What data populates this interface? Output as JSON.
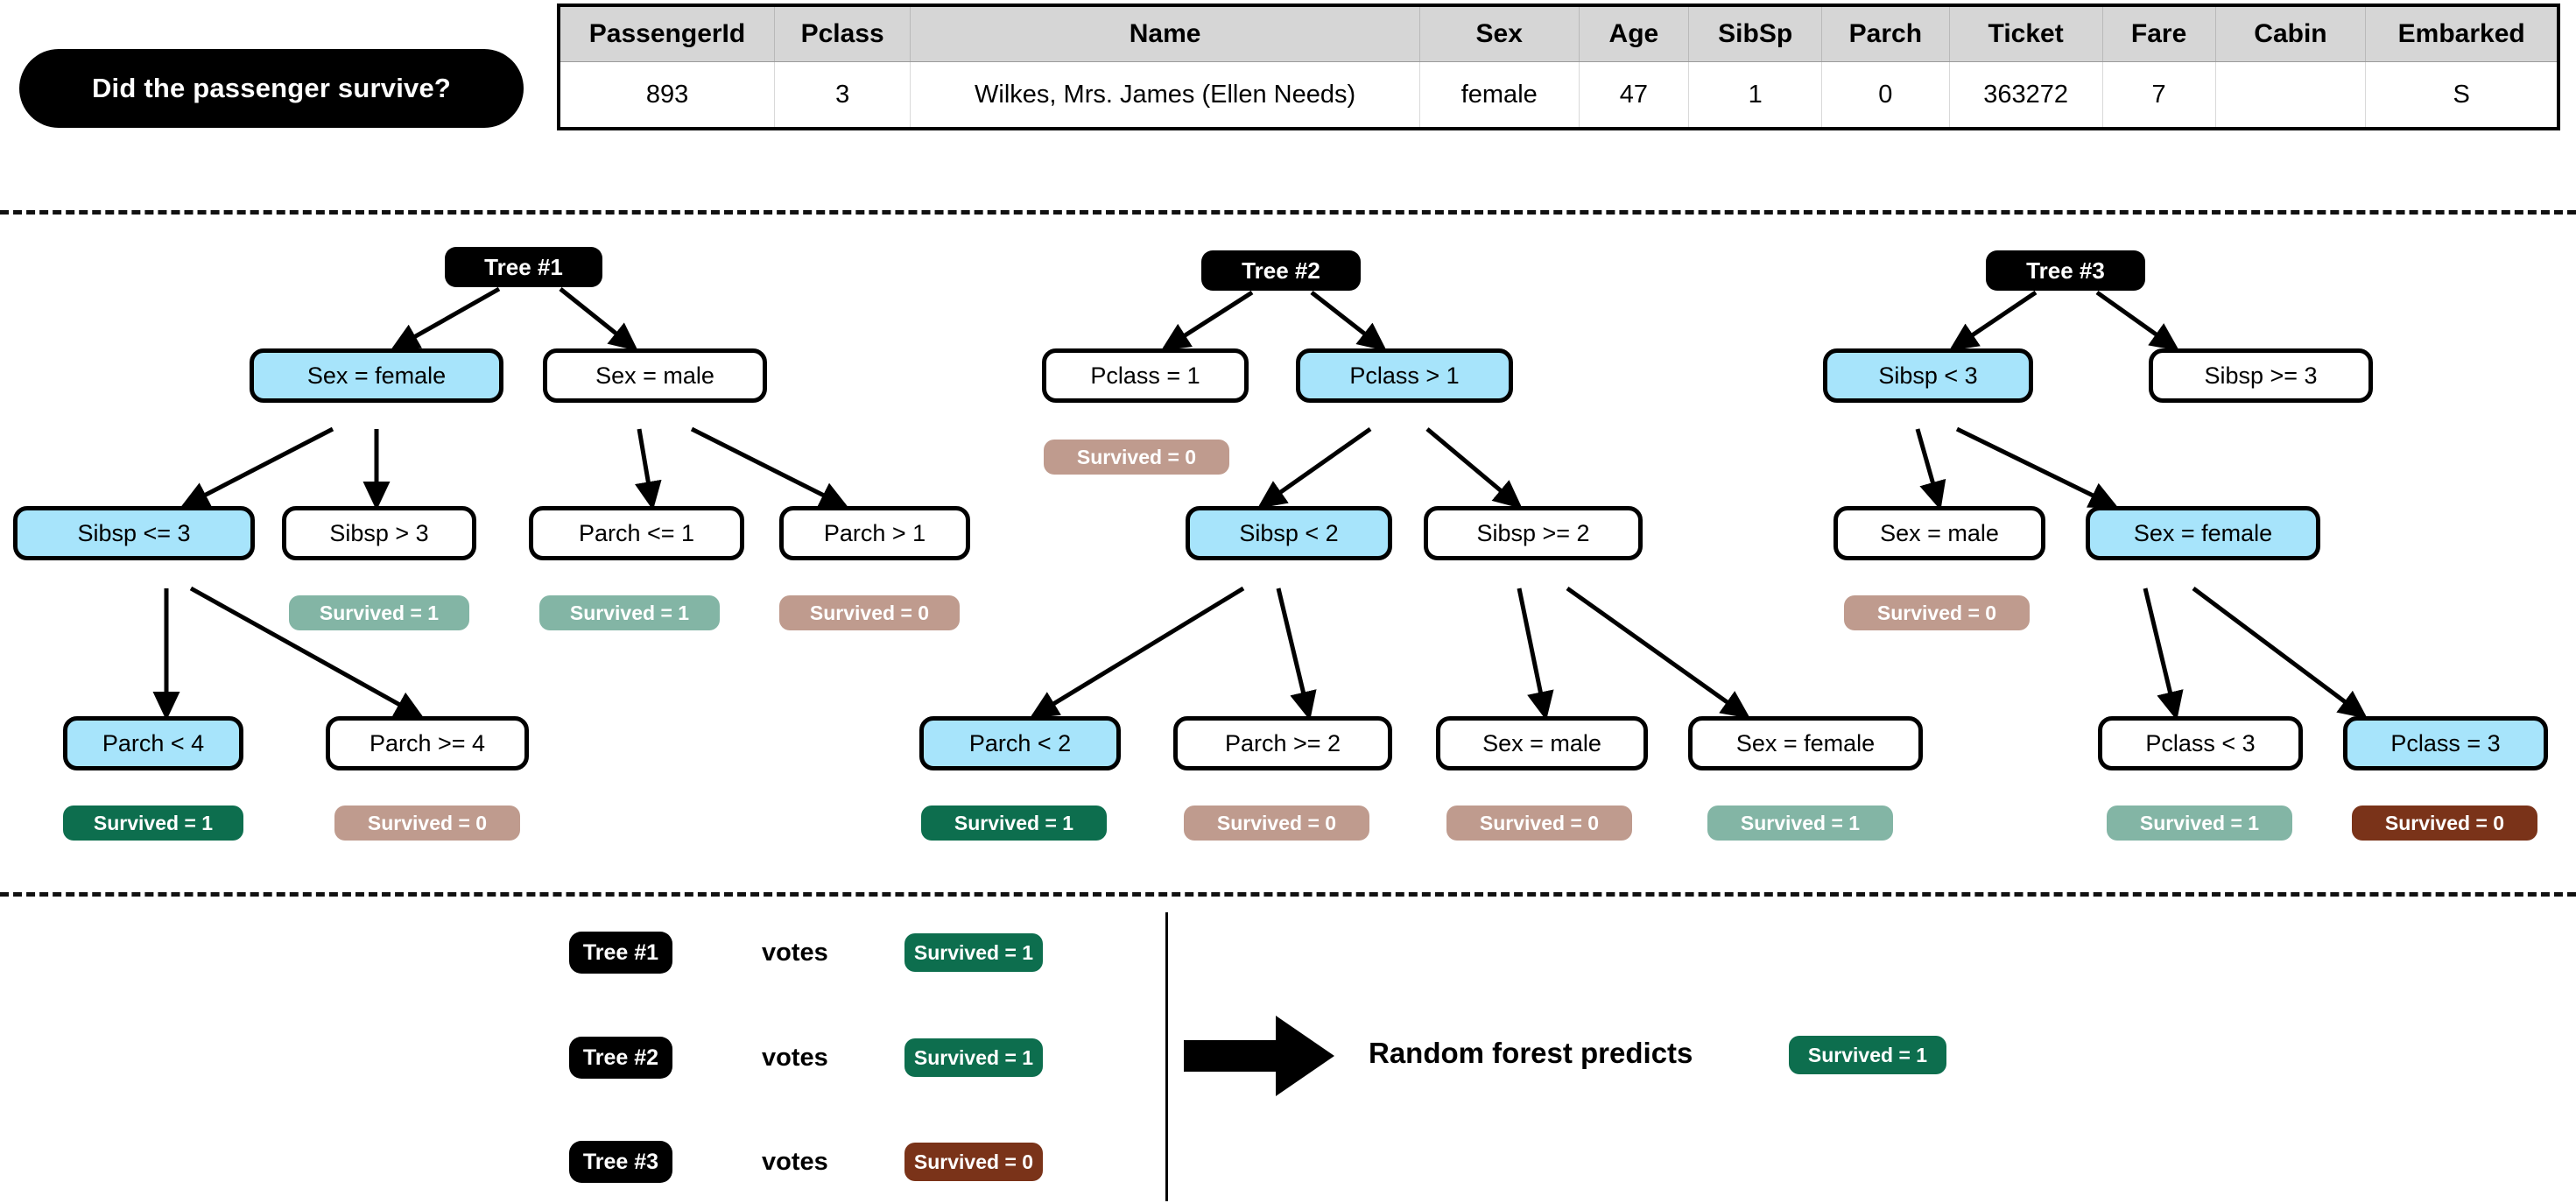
{
  "question": {
    "text": "Did the passenger survive?"
  },
  "passenger_table": {
    "headers": [
      "PassengerId",
      "Pclass",
      "Name",
      "Sex",
      "Age",
      "SibSp",
      "Parch",
      "Ticket",
      "Fare",
      "Cabin",
      "Embarked"
    ],
    "rows": [
      [
        "893",
        "3",
        "Wilkes, Mrs. James (Ellen Needs)",
        "female",
        "47",
        "1",
        "0",
        "363272",
        "7",
        "",
        "S"
      ]
    ]
  },
  "colors": {
    "highlight_node": "#a7e4fb",
    "survived1_light": "#83b5a5",
    "survived0_light": "#bf9b8e",
    "survived1_dark": "#0d6e4e",
    "survived0_dark": "#7a3319",
    "root_pill": "#000000",
    "table_header": "#d6d6d6"
  },
  "trees": [
    {
      "root_label": "Tree #1",
      "nodes": [
        {
          "id": "t1-l1a",
          "label": "Sex = female",
          "highlight": true
        },
        {
          "id": "t1-l1b",
          "label": "Sex = male",
          "highlight": false
        },
        {
          "id": "t1-l2a",
          "label": "Sibsp <= 3",
          "highlight": true
        },
        {
          "id": "t1-l2b",
          "label": "Sibsp > 3",
          "highlight": false
        },
        {
          "id": "t1-l2c",
          "label": "Parch <= 1",
          "highlight": false
        },
        {
          "id": "t1-l2d",
          "label": "Parch > 1",
          "highlight": false
        },
        {
          "id": "t1-l3a",
          "label": "Parch < 4",
          "highlight": true
        },
        {
          "id": "t1-l3b",
          "label": "Parch >= 4",
          "highlight": false
        }
      ],
      "leaves": [
        {
          "id": "t1-lf1",
          "label": "Survived = 1",
          "style": "surv1"
        },
        {
          "id": "t1-lf2",
          "label": "Survived = 1",
          "style": "surv1"
        },
        {
          "id": "t1-lf3",
          "label": "Survived = 0",
          "style": "surv0"
        },
        {
          "id": "t1-lf4",
          "label": "Survived = 1",
          "style": "surv1-dark"
        },
        {
          "id": "t1-lf5",
          "label": "Survived = 0",
          "style": "surv0"
        }
      ]
    },
    {
      "root_label": "Tree #2",
      "nodes": [
        {
          "id": "t2-l1a",
          "label": "Pclass = 1",
          "highlight": false
        },
        {
          "id": "t2-l1b",
          "label": "Pclass > 1",
          "highlight": true
        },
        {
          "id": "t2-l2a",
          "label": "Sibsp < 2",
          "highlight": true
        },
        {
          "id": "t2-l2b",
          "label": "Sibsp >= 2",
          "highlight": false
        },
        {
          "id": "t2-l3a",
          "label": "Parch < 2",
          "highlight": true
        },
        {
          "id": "t2-l3b",
          "label": "Parch >= 2",
          "highlight": false
        },
        {
          "id": "t2-l3c",
          "label": "Sex = male",
          "highlight": false
        },
        {
          "id": "t2-l3d",
          "label": "Sex = female",
          "highlight": false
        }
      ],
      "leaves": [
        {
          "id": "t2-lf1",
          "label": "Survived = 0",
          "style": "surv0"
        },
        {
          "id": "t2-lf2",
          "label": "Survived = 1",
          "style": "surv1-dark"
        },
        {
          "id": "t2-lf3",
          "label": "Survived = 0",
          "style": "surv0"
        },
        {
          "id": "t2-lf4",
          "label": "Survived = 0",
          "style": "surv0"
        },
        {
          "id": "t2-lf5",
          "label": "Survived = 1",
          "style": "surv1"
        }
      ]
    },
    {
      "root_label": "Tree #3",
      "nodes": [
        {
          "id": "t3-l1a",
          "label": "Sibsp < 3",
          "highlight": true
        },
        {
          "id": "t3-l1b",
          "label": "Sibsp >= 3",
          "highlight": false
        },
        {
          "id": "t3-l2a",
          "label": "Sex = male",
          "highlight": false
        },
        {
          "id": "t3-l2b",
          "label": "Sex = female",
          "highlight": true
        },
        {
          "id": "t3-l3a",
          "label": "Pclass < 3",
          "highlight": false
        },
        {
          "id": "t3-l3b",
          "label": "Pclass = 3",
          "highlight": true
        }
      ],
      "leaves": [
        {
          "id": "t3-lf1",
          "label": "Survived = 0",
          "style": "surv0"
        },
        {
          "id": "t3-lf2",
          "label": "Survived = 1",
          "style": "surv1"
        },
        {
          "id": "t3-lf3",
          "label": "Survived = 0",
          "style": "surv0-dark"
        }
      ]
    }
  ],
  "voting": {
    "votes_word": "votes",
    "rows": [
      {
        "tree": "Tree #1",
        "badge": "Survived = 1",
        "style": "green"
      },
      {
        "tree": "Tree #2",
        "badge": "Survived = 1",
        "style": "green"
      },
      {
        "tree": "Tree #3",
        "badge": "Survived = 0",
        "style": "brown"
      }
    ],
    "prediction_label": "Random forest predicts",
    "prediction_badge": "Survived = 1"
  }
}
